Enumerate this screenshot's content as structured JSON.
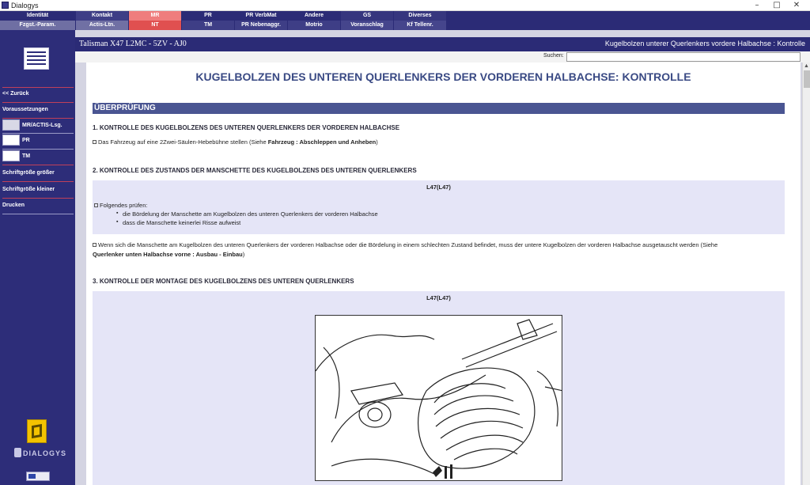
{
  "window": {
    "title": "Dialogys"
  },
  "nav": [
    {
      "top": "Identität",
      "bottom": "Fzgst.-Param."
    },
    {
      "top": "Kontakt",
      "bottom": "Actis-Ltn."
    },
    {
      "top": "MR",
      "bottom": "NT"
    },
    {
      "top": "PR",
      "bottom": "TM"
    },
    {
      "top": "PR VerbMat",
      "bottom": "PR Nebenaggr."
    },
    {
      "top": "Andere",
      "bottom": "Motrio"
    },
    {
      "top": "GS",
      "bottom": "Voranschlag"
    },
    {
      "top": "Diverses",
      "bottom": "Kf Tellenr."
    }
  ],
  "sidebar": {
    "items": [
      {
        "label": "<< Zurück"
      },
      {
        "label": "Voraussetzungen"
      },
      {
        "label": "MR/ACTIS-Lsg."
      },
      {
        "label": "PR"
      },
      {
        "label": "TM"
      },
      {
        "label": "Schriftgröße größer"
      },
      {
        "label": "Schriftgröße kleiner"
      },
      {
        "label": "Drucken"
      }
    ],
    "brand": "DIALOGYS"
  },
  "header": {
    "vehicle": "Talisman X47 L2MC - 5ZV - AJ0",
    "breadcrumb": "Kugelbolzen unterer Querlenkers vordere Halbachse : Kontrolle"
  },
  "search": {
    "label": "Suchen:",
    "value": ""
  },
  "doc": {
    "title": "KUGELBOLZEN DES UNTEREN QUERLENKERS DER VORDEREN HALBACHSE: KONTROLLE",
    "section": "ÜBERPRÜFUNG",
    "step1_heading": "1. KONTROLLE DES KUGELBOLZENS DES UNTEREN QUERLENKERS DER VORDEREN HALBACHSE",
    "step1_text": "Das Fahrzeug auf eine 2Zwei-Säulen-Hebebühne stellen (Siehe ",
    "step1_ref": "Fahrzeug : Abschleppen und Anheben",
    "step1_end": ")",
    "step2_heading": "2. KONTROLLE DES ZUSTANDS DER MANSCHETTE DES KUGELBOLZENS DES UNTEREN QUERLENKERS",
    "box1_caption": "L47(L47)",
    "box1_intro": "Folgendes prüfen:",
    "box1_bullet1": "die Bördelung der Manschette am Kugelbolzen des unteren Querlenkers der vorderen Halbachse",
    "box1_bullet2": "dass die Manschette keinerlei Risse aufweist",
    "warning_text": "Wenn sich die Manschette am Kugelbolzen des unteren Querlenkers der vorderen Halbachse oder die Bördelung in einem schlechten Zustand befindet, muss der untere Kugelbolzen der vorderen Halbachse ausgetauscht werden (Siehe",
    "warning_ref": "Querlenker unten Halbachse vorne : Ausbau - Einbau",
    "warning_end": ")",
    "step3_heading": "3. KONTROLLE DER MONTAGE DES KUGELBOLZENS DES UNTEREN QUERLENKERS",
    "box2_caption": "L47(L47)"
  }
}
